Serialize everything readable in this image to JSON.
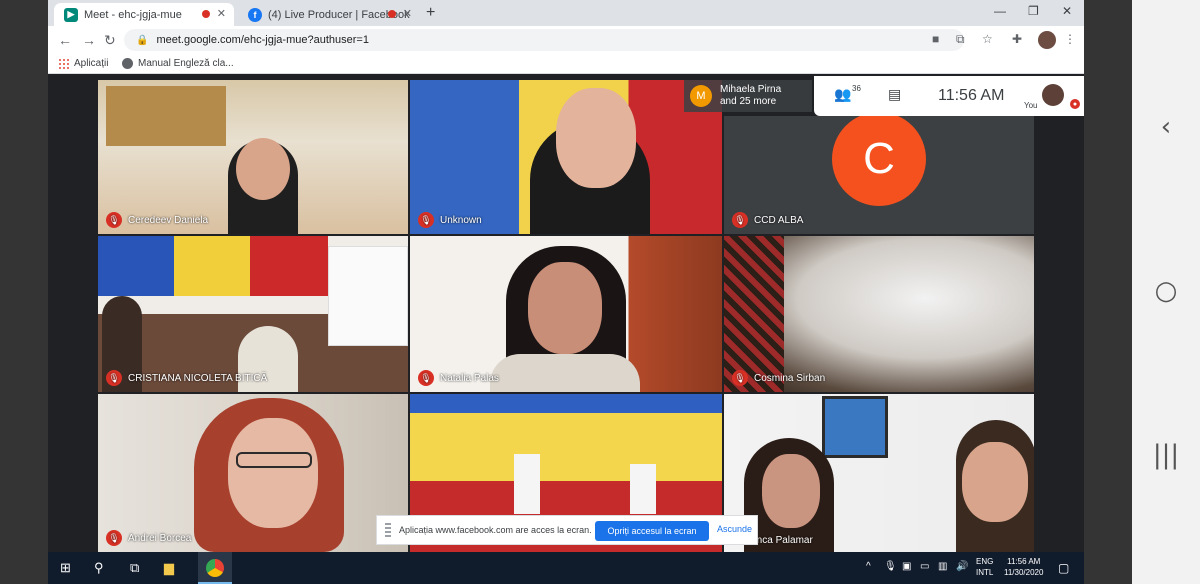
{
  "browser": {
    "tabs": [
      {
        "title": "Meet - ehc-jgja-mue",
        "active": true,
        "recording": true
      },
      {
        "title": "(4) Live Producer | Facebook",
        "active": false,
        "recording": true
      }
    ],
    "url": "meet.google.com/ehc-jgja-mue?authuser=1",
    "bookmarks": [
      {
        "label": "Aplicații"
      },
      {
        "label": "Manual Engleză cla..."
      }
    ]
  },
  "meet": {
    "participants_preview": {
      "initial": "M",
      "line1": "Mihaela Pirna",
      "line2": "and 25 more"
    },
    "participant_count": "36",
    "time": "11:56 AM",
    "you_label": "You",
    "tiles": [
      {
        "name": "Ceredeev Daniela",
        "muted": true
      },
      {
        "name": "Unknown",
        "muted": true
      },
      {
        "name": "CCD ALBA",
        "muted": true,
        "avatar_initial": "C"
      },
      {
        "name": "CRISTIANA NICOLETA BITICĂ",
        "muted": true
      },
      {
        "name": "Natalia Palas",
        "muted": true
      },
      {
        "name": "Cosmina Sirban",
        "muted": true
      },
      {
        "name": "Andrei Borcea",
        "muted": true
      },
      {
        "name": "",
        "muted": false
      },
      {
        "name": "Anca Palamar",
        "muted": false
      }
    ],
    "share_banner": {
      "message": "Aplicația www.facebook.com are acces la ecran.",
      "stop_label": "Opriți accesul la ecran",
      "hide_label": "Ascunde"
    }
  },
  "taskbar": {
    "lang_line1": "ENG",
    "lang_line2": "INTL",
    "time": "11:56 AM",
    "date": "11/30/2020"
  },
  "colors": {
    "meet_bg": "#202124",
    "mic_off": "#d93025",
    "ccd_avatar": "#f4511e",
    "share_button": "#1a73e8"
  }
}
